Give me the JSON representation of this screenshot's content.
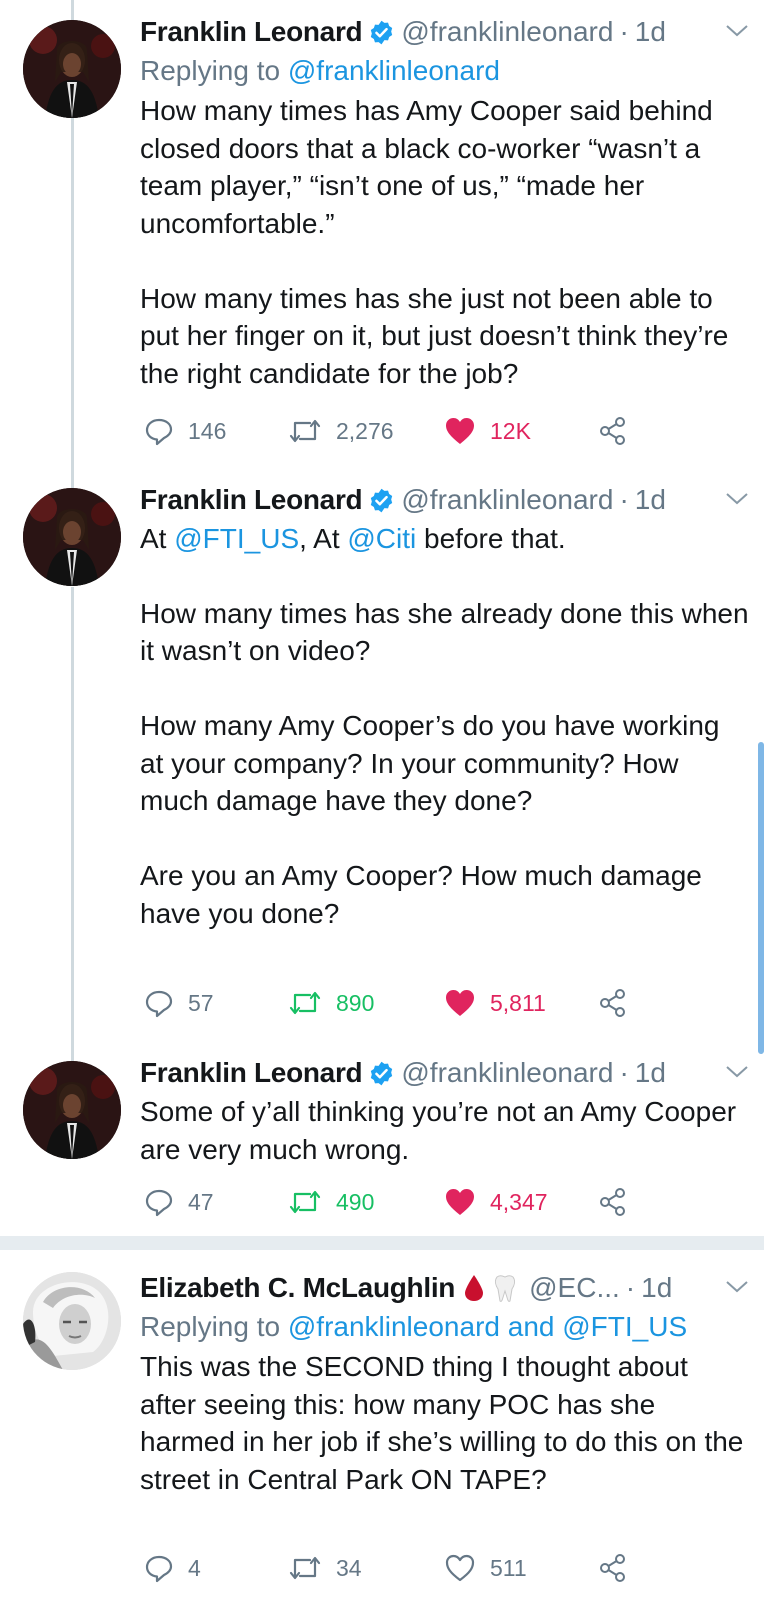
{
  "colors": {
    "accent": "#1b95e0",
    "secondary_text": "#657786",
    "retweet_active": "#17bf63",
    "like_active": "#e0245e",
    "thread_line": "#cfd9de"
  },
  "tweets": [
    {
      "name": "Franklin Leonard",
      "handle": "@franklinleonard",
      "time": "1d",
      "reply_label": "Replying to",
      "reply_to": "@franklinleonard",
      "text": "How many times has Amy Cooper said behind closed doors that a black co-worker “wasn’t a team player,” “isn’t one of us,” “made her uncomfortable.”\n\nHow many times has she just not been able to put her finger on it, but just doesn’t think they’re the right candidate for the job?",
      "replies": "146",
      "retweets": "2,276",
      "likes": "12K",
      "retweeted": false,
      "liked": true
    },
    {
      "name": "Franklin Leonard",
      "handle": "@franklinleonard",
      "time": "1d",
      "text_parts": [
        "At ",
        "@FTI_US",
        ", At ",
        "@Citi",
        " before that."
      ],
      "text": "How many times has she already done this when it wasn’t on video?\n\nHow many Amy Cooper’s do you have working at your company? In your community? How much damage have they done?\n\nAre you an Amy Cooper? How much damage have you done?",
      "replies": "57",
      "retweets": "890",
      "likes": "5,811",
      "retweeted": true,
      "liked": true
    },
    {
      "name": "Franklin Leonard",
      "handle": "@franklinleonard",
      "time": "1d",
      "text": "Some of y’all thinking you’re not an Amy Cooper are very much wrong.",
      "replies": "47",
      "retweets": "490",
      "likes": "4,347",
      "retweeted": true,
      "liked": true
    },
    {
      "name": "Elizabeth C. McLaughlin",
      "handle": "@EC...",
      "time": "1d",
      "reply_label": "Replying to",
      "reply_to": "@franklinleonard and @FTI_US",
      "text": "This was the SECOND thing I thought about after seeing this: how many POC has she harmed in her job if she’s willing to do this on the street in Central Park ON TAPE?",
      "replies": "4",
      "retweets": "34",
      "likes": "511",
      "retweeted": false,
      "liked": false
    }
  ]
}
